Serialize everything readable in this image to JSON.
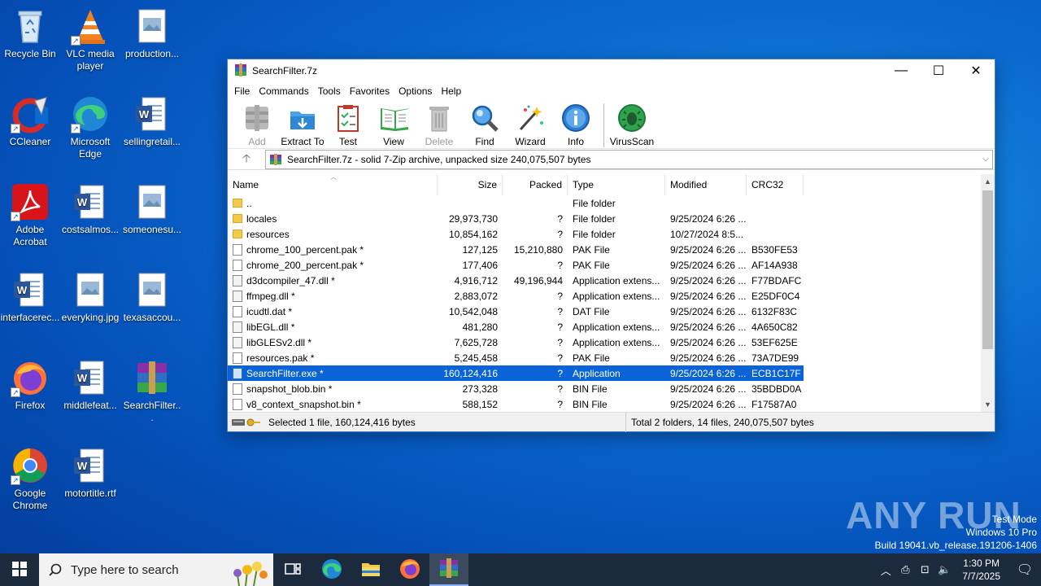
{
  "desktop": {
    "icons": [
      {
        "label": "Recycle Bin"
      },
      {
        "label": "VLC media player"
      },
      {
        "label": "production..."
      },
      {
        "label": "CCleaner"
      },
      {
        "label": "Microsoft Edge"
      },
      {
        "label": "sellingretail..."
      },
      {
        "label": "Adobe Acrobat"
      },
      {
        "label": "costsalmos..."
      },
      {
        "label": "someonesu..."
      },
      {
        "label": "interfacerec..."
      },
      {
        "label": "everyking.jpg"
      },
      {
        "label": "texasaccou..."
      },
      {
        "label": "Firefox"
      },
      {
        "label": "middlefeat..."
      },
      {
        "label": "SearchFilter..."
      },
      {
        "label": "Google Chrome"
      },
      {
        "label": "motortitle.rtf"
      }
    ]
  },
  "window": {
    "title": "SearchFilter.7z",
    "controls": {
      "minimize": "—",
      "maximize": "☐",
      "close": "✕"
    },
    "menu": [
      "File",
      "Commands",
      "Tools",
      "Favorites",
      "Options",
      "Help"
    ],
    "toolbar": [
      {
        "label": "Add",
        "icon": "add-icon",
        "enabled": false
      },
      {
        "label": "Extract To",
        "icon": "extract-icon",
        "enabled": true
      },
      {
        "label": "Test",
        "icon": "test-icon",
        "enabled": true
      },
      {
        "label": "View",
        "icon": "view-icon",
        "enabled": true
      },
      {
        "label": "Delete",
        "icon": "delete-icon",
        "enabled": false
      },
      {
        "label": "Find",
        "icon": "find-icon",
        "enabled": true
      },
      {
        "label": "Wizard",
        "icon": "wizard-icon",
        "enabled": true
      },
      {
        "label": "Info",
        "icon": "info-icon",
        "enabled": true
      },
      {
        "label": "VirusScan",
        "icon": "virusscan-icon",
        "enabled": true
      }
    ],
    "address": {
      "up_arrow": "🡡",
      "path": "SearchFilter.7z - solid 7-Zip archive, unpacked size 240,075,507 bytes",
      "dropdown": "⌵"
    },
    "columns": [
      "Name",
      "Size",
      "Packed",
      "Type",
      "Modified",
      "CRC32"
    ],
    "rows": [
      {
        "name": "..",
        "size": "",
        "packed": "",
        "type": "File folder",
        "modified": "",
        "crc": "",
        "kind": "folder"
      },
      {
        "name": "locales",
        "size": "29,973,730",
        "packed": "?",
        "type": "File folder",
        "modified": "9/25/2024 6:26 ...",
        "crc": "",
        "kind": "folder"
      },
      {
        "name": "resources",
        "size": "10,854,162",
        "packed": "?",
        "type": "File folder",
        "modified": "10/27/2024 8:5...",
        "crc": "",
        "kind": "folder"
      },
      {
        "name": "chrome_100_percent.pak *",
        "size": "127,125",
        "packed": "15,210,880",
        "type": "PAK File",
        "modified": "9/25/2024 6:26 ...",
        "crc": "B530FE53",
        "kind": "file"
      },
      {
        "name": "chrome_200_percent.pak *",
        "size": "177,406",
        "packed": "?",
        "type": "PAK File",
        "modified": "9/25/2024 6:26 ...",
        "crc": "AF14A938",
        "kind": "file"
      },
      {
        "name": "d3dcompiler_47.dll *",
        "size": "4,916,712",
        "packed": "49,196,944",
        "type": "Application extens...",
        "modified": "9/25/2024 6:26 ...",
        "crc": "F77BDAFC",
        "kind": "dll"
      },
      {
        "name": "ffmpeg.dll *",
        "size": "2,883,072",
        "packed": "?",
        "type": "Application extens...",
        "modified": "9/25/2024 6:26 ...",
        "crc": "E25DF0C4",
        "kind": "dll"
      },
      {
        "name": "icudtl.dat *",
        "size": "10,542,048",
        "packed": "?",
        "type": "DAT File",
        "modified": "9/25/2024 6:26 ...",
        "crc": "6132F83C",
        "kind": "file"
      },
      {
        "name": "libEGL.dll *",
        "size": "481,280",
        "packed": "?",
        "type": "Application extens...",
        "modified": "9/25/2024 6:26 ...",
        "crc": "4A650C82",
        "kind": "dll"
      },
      {
        "name": "libGLESv2.dll *",
        "size": "7,625,728",
        "packed": "?",
        "type": "Application extens...",
        "modified": "9/25/2024 6:26 ...",
        "crc": "53EF625E",
        "kind": "dll"
      },
      {
        "name": "resources.pak *",
        "size": "5,245,458",
        "packed": "?",
        "type": "PAK File",
        "modified": "9/25/2024 6:26 ...",
        "crc": "73A7DE99",
        "kind": "file"
      },
      {
        "name": "SearchFilter.exe *",
        "size": "160,124,416",
        "packed": "?",
        "type": "Application",
        "modified": "9/25/2024 6:26 ...",
        "crc": "ECB1C17F",
        "kind": "exe",
        "selected": true
      },
      {
        "name": "snapshot_blob.bin *",
        "size": "273,328",
        "packed": "?",
        "type": "BIN File",
        "modified": "9/25/2024 6:26 ...",
        "crc": "35BDBD0A",
        "kind": "file"
      },
      {
        "name": "v8_context_snapshot.bin *",
        "size": "588,152",
        "packed": "?",
        "type": "BIN File",
        "modified": "9/25/2024 6:26 ...",
        "crc": "F17587A0",
        "kind": "file"
      }
    ],
    "status": {
      "left": "Selected 1 file, 160,124,416 bytes",
      "right": "Total 2 folders, 14 files, 240,075,507 bytes"
    }
  },
  "watermark": "ANY RUN",
  "system_info": {
    "line1": "Test Mode",
    "line2": "Windows 10 Pro",
    "line3": "Build 19041.vb_release.191206-1406"
  },
  "taskbar": {
    "search_placeholder": "Type here to search",
    "clock_time": "1:30 PM",
    "clock_date": "7/7/2025",
    "tray_icons": [
      "chevron-up-icon",
      "network-monitor-icon",
      "network-icon",
      "volume-icon"
    ]
  },
  "colors": {
    "selection": "#0a64d8",
    "taskbar": "#1b2a3d",
    "desktop": "#0a6ad0"
  }
}
